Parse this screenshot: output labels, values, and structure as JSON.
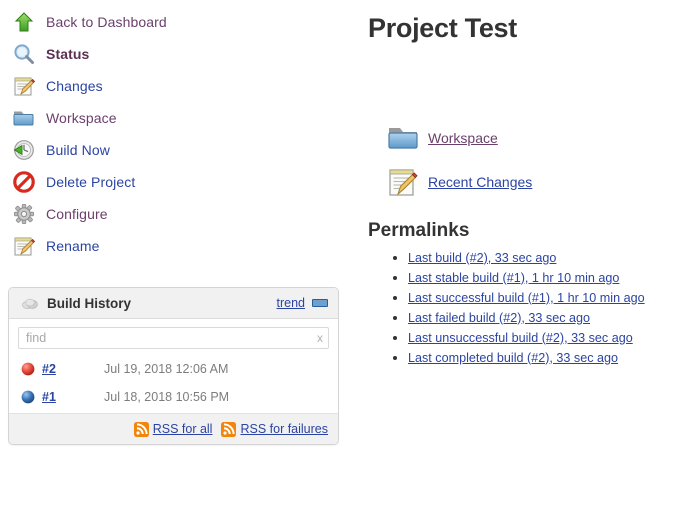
{
  "sidebar": {
    "tasks": [
      {
        "label": "Back to Dashboard",
        "icon": "up-arrow-icon",
        "state": "visited"
      },
      {
        "label": "Status",
        "icon": "magnifier-icon",
        "state": "current"
      },
      {
        "label": "Changes",
        "icon": "notepad-pencil-icon",
        "state": "link"
      },
      {
        "label": "Workspace",
        "icon": "folder-icon",
        "state": "visited"
      },
      {
        "label": "Build Now",
        "icon": "build-now-icon",
        "state": "link"
      },
      {
        "label": "Delete Project",
        "icon": "delete-icon",
        "state": "link"
      },
      {
        "label": "Configure",
        "icon": "gear-icon",
        "state": "visited"
      },
      {
        "label": "Rename",
        "icon": "notepad-pencil-icon",
        "state": "link"
      }
    ]
  },
  "build_history": {
    "title": "Build History",
    "weather_icon": "cloudy-weather-icon",
    "trend_label": "trend",
    "find": {
      "value": "",
      "placeholder": "find",
      "clear_label": "x"
    },
    "rows": [
      {
        "status": "failed",
        "ball_color": "#e5493a",
        "number": "#2",
        "date": "Jul 19, 2018 12:06 AM"
      },
      {
        "status": "success",
        "ball_color": "#3a73b8",
        "number": "#1",
        "date": "Jul 18, 2018 10:56 PM"
      }
    ],
    "rss_all": "RSS for all",
    "rss_failures": "RSS for failures"
  },
  "main": {
    "title": "Project Test",
    "links": [
      {
        "label": "Workspace",
        "icon": "folder-icon",
        "state": "visited"
      },
      {
        "label": "Recent Changes",
        "icon": "notepad-pencil-icon",
        "state": "link"
      }
    ],
    "permalinks_title": "Permalinks",
    "permalinks": [
      "Last build (#2), 33 sec ago",
      "Last stable build (#1), 1 hr 10 min ago",
      "Last successful build (#1), 1 hr 10 min ago",
      "Last failed build (#2), 33 sec ago",
      "Last unsuccessful build (#2), 33 sec ago",
      "Last completed build (#2), 33 sec ago"
    ]
  },
  "colors": {
    "link": "#2b44a3",
    "visited": "#6b3f6b",
    "rss_orange": "#f0860c",
    "failed_red": "#e5493a",
    "success_blue": "#3a73b8",
    "panel_header": "#f1f1f1",
    "panel_border": "#d4d4d4"
  }
}
